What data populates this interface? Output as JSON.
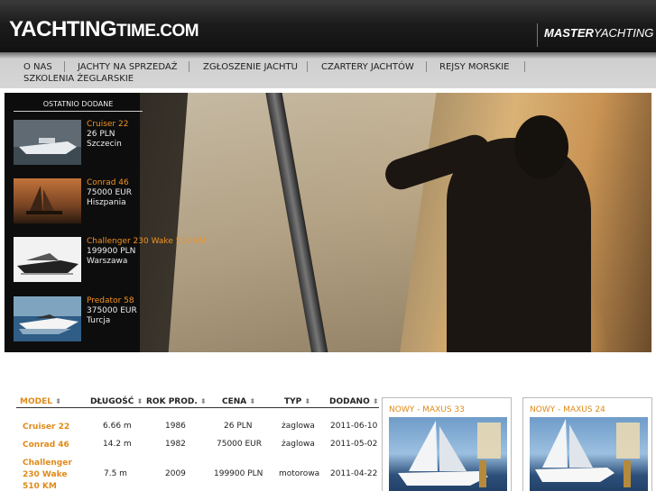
{
  "header": {
    "logo_main": "YACHTING",
    "logo_suffix": "TIME.COM",
    "partner_bold": "MASTER",
    "partner_light": "YACHTING"
  },
  "nav": {
    "items": [
      "O NAS",
      "JACHTY NA SPRZEDAŻ",
      "ZGŁOSZENIE JACHTU",
      "CZARTERY JACHTÓW",
      "REJSY MORSKIE",
      "SZKOLENIA ŻEGLARSKIE"
    ]
  },
  "recent": {
    "title": "OSTATNIO DODANE",
    "boats": [
      {
        "name": "Cruiser 22",
        "price": "26 PLN",
        "location": "Szczecin"
      },
      {
        "name": "Conrad 46",
        "price": "75000 EUR",
        "location": "Hiszpania"
      },
      {
        "name": "Challenger 230 Wake 510 KM",
        "price": "199900 PLN",
        "location": "Warszawa"
      },
      {
        "name": "Predator 58",
        "price": "375000 EUR",
        "location": "Turcja"
      }
    ]
  },
  "table": {
    "sort_icon": "⬍",
    "headers": [
      "MODEL",
      "DŁUGOŚĆ",
      "ROK PROD.",
      "CENA",
      "TYP",
      "DODANO"
    ],
    "rows": [
      {
        "model": "Cruiser 22",
        "length": "6.66 m",
        "year": "1986",
        "price": "26 PLN",
        "type": "żaglowa",
        "added": "2011-06-10"
      },
      {
        "model": "Conrad 46",
        "length": "14.2 m",
        "year": "1982",
        "price": "75000 EUR",
        "type": "żaglowa",
        "added": "2011-05-02"
      },
      {
        "model": "Challenger 230 Wake 510 KM",
        "length": "7.5 m",
        "year": "2009",
        "price": "199900 PLN",
        "type": "motorowa",
        "added": "2011-04-22"
      }
    ]
  },
  "promos": [
    {
      "title": "NOWY - MAXUS 33"
    },
    {
      "title": "NOWY - MAXUS 24"
    }
  ],
  "colors": {
    "accent": "#e08a18",
    "header_bg": "#1c1c1c"
  }
}
